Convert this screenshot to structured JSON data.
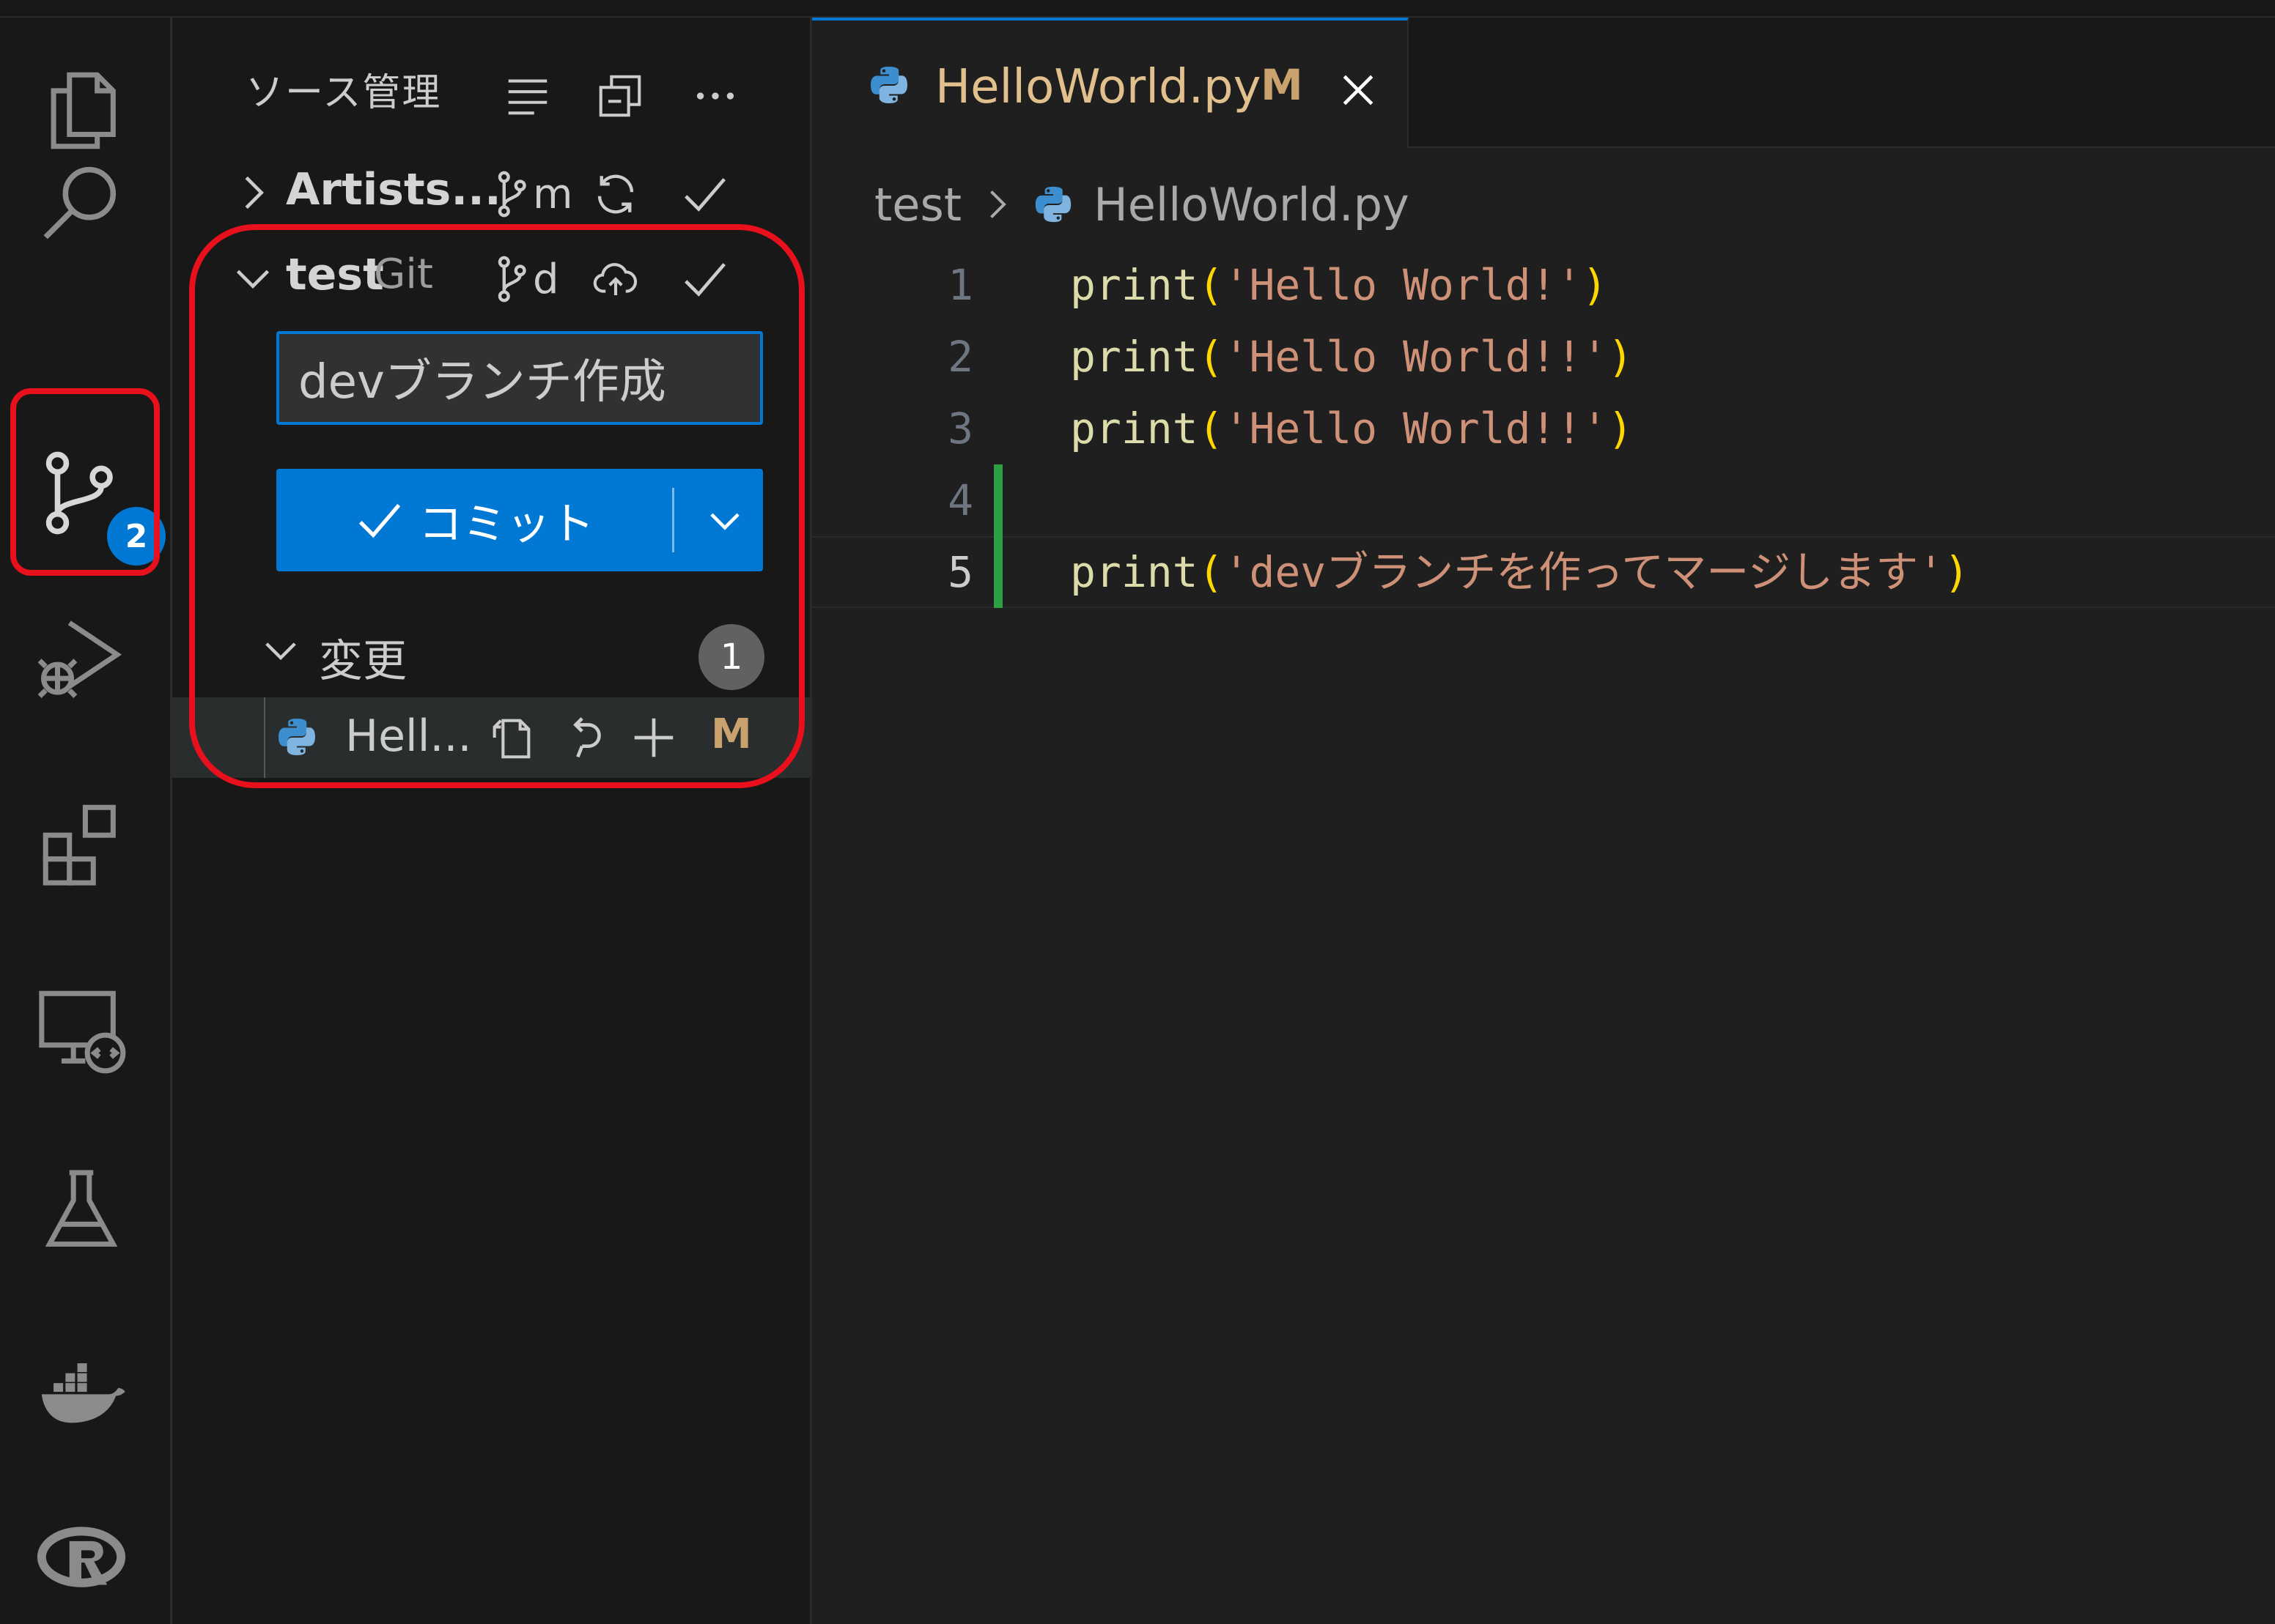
{
  "activity_bar": {
    "items": [
      {
        "name": "explorer-icon"
      },
      {
        "name": "search-icon"
      },
      {
        "name": "source-control-icon",
        "badge": "2"
      },
      {
        "name": "run-debug-icon"
      },
      {
        "name": "extensions-icon"
      },
      {
        "name": "remote-explorer-icon"
      },
      {
        "name": "testing-icon"
      },
      {
        "name": "docker-icon"
      },
      {
        "name": "r-icon"
      }
    ]
  },
  "sidebar": {
    "title": "ソース管理",
    "repos": [
      {
        "name": "Artists...",
        "branch": "m",
        "expanded": false
      },
      {
        "name": "test",
        "provider": "Git",
        "branch": "d",
        "expanded": true
      }
    ],
    "commit_input_value": "devブランチ作成",
    "commit_button_label": "コミット",
    "changes": {
      "label": "変更",
      "count": "1",
      "files": [
        {
          "name": "Hell...",
          "status": "M"
        }
      ]
    }
  },
  "editor": {
    "tab": {
      "title": "HelloWorld.py",
      "status": "M"
    },
    "breadcrumb": [
      "test",
      "HelloWorld.py"
    ],
    "lines": [
      {
        "num": "1",
        "fn": "print",
        "open": "(",
        "str": "'Hello World!'",
        "close": ")"
      },
      {
        "num": "2",
        "fn": "print",
        "open": "(",
        "str": "'Hello World!!'",
        "close": ")"
      },
      {
        "num": "3",
        "fn": "print",
        "open": "(",
        "str": "'Hello World!!'",
        "close": ")"
      },
      {
        "num": "4",
        "fn": "",
        "open": "",
        "str": "",
        "close": ""
      },
      {
        "num": "5",
        "fn": "print",
        "open": "(",
        "str": "'devブランチを作ってマージします'",
        "close": ")"
      }
    ]
  },
  "colors": {
    "accent": "#0078d4",
    "annotation": "#e8101c",
    "modified": "#c9a26d",
    "added_gutter": "#2ea043"
  }
}
